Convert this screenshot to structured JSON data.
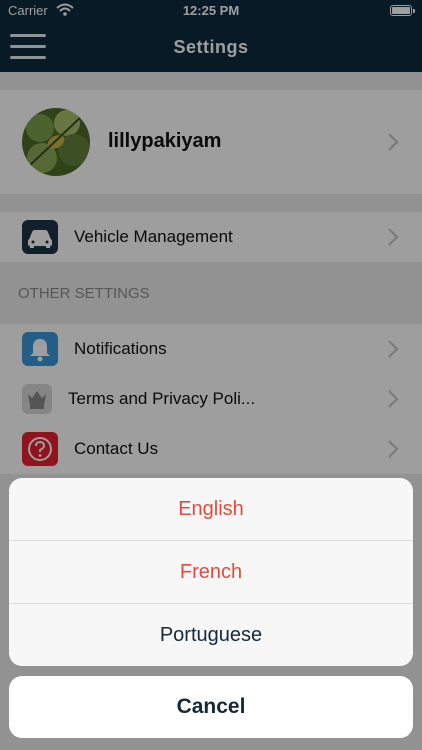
{
  "status_bar": {
    "carrier": "Carrier",
    "time": "12:25 PM"
  },
  "header": {
    "title": "Settings"
  },
  "profile": {
    "name": "lillypakiyam"
  },
  "vehicle": {
    "label": "Vehicle Management",
    "icon": "car-icon"
  },
  "other_settings": {
    "header": "OTHER SETTINGS",
    "items": [
      {
        "label": "Notifications",
        "icon": "bell-icon"
      },
      {
        "label": "Terms and Privacy Poli...",
        "icon": "crest-icon"
      },
      {
        "label": "Contact Us",
        "icon": "question-icon"
      }
    ]
  },
  "action_sheet": {
    "options": [
      {
        "label": "English"
      },
      {
        "label": "French"
      },
      {
        "label": "Portuguese"
      }
    ],
    "cancel": "Cancel"
  },
  "colors": {
    "nav": "#0e2a3c",
    "destructive": "#e14b3f",
    "accent": "#16293b"
  }
}
